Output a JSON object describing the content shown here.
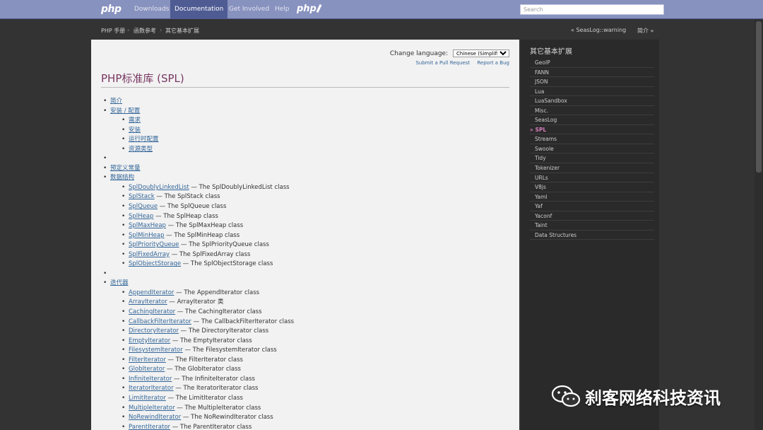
{
  "topnav": {
    "logo": "php",
    "links": [
      "Downloads",
      "Documentation",
      "Get Involved",
      "Help"
    ],
    "logo2": "php",
    "search_placeholder": "Search"
  },
  "breadcrumb": {
    "items": [
      "PHP 手册",
      "函数参考",
      "其它基本扩展"
    ],
    "prev": "« SeasLog::warning",
    "next": "简介 »"
  },
  "content": {
    "change_language_label": "Change language:",
    "language_selected": "Chinese (Simplified)",
    "submit_pull_request": "Submit a Pull Request",
    "report_bug": "Report a Bug",
    "title": "PHP标准库 (SPL)",
    "toc": {
      "intro": "简介",
      "setup": "安装 / 配置",
      "setup_items": [
        "需求",
        "安装",
        "运行时配置",
        "资源类型"
      ],
      "constants": "预定义常量",
      "datastructures": "数据结构",
      "ds_items": [
        {
          "link": "SplDoublyLinkedList",
          "desc": " — The SplDoublyLinkedList class"
        },
        {
          "link": "SplStack",
          "desc": " — The SplStack class"
        },
        {
          "link": "SplQueue",
          "desc": " — The SplQueue class"
        },
        {
          "link": "SplHeap",
          "desc": " — The SplHeap class"
        },
        {
          "link": "SplMaxHeap",
          "desc": " — The SplMaxHeap class"
        },
        {
          "link": "SplMinHeap",
          "desc": " — The SplMinHeap class"
        },
        {
          "link": "SplPriorityQueue",
          "desc": " — The SplPriorityQueue class"
        },
        {
          "link": "SplFixedArray",
          "desc": " — The SplFixedArray class"
        },
        {
          "link": "SplObjectStorage",
          "desc": " — The SplObjectStorage class"
        }
      ],
      "iterators": "迭代器",
      "it_items": [
        {
          "link": "AppendIterator",
          "desc": " — The AppendIterator class"
        },
        {
          "link": "ArrayIterator",
          "desc": " — ArrayIterator 类"
        },
        {
          "link": "CachingIterator",
          "desc": " — The CachingIterator class"
        },
        {
          "link": "CallbackFilterIterator",
          "desc": " — The CallbackFilterIterator class"
        },
        {
          "link": "DirectoryIterator",
          "desc": " — The DirectoryIterator class"
        },
        {
          "link": "EmptyIterator",
          "desc": " — The EmptyIterator class"
        },
        {
          "link": "FilesystemIterator",
          "desc": " — The FilesystemIterator class"
        },
        {
          "link": "FilterIterator",
          "desc": " — The FilterIterator class"
        },
        {
          "link": "GlobIterator",
          "desc": " — The GlobIterator class"
        },
        {
          "link": "InfiniteIterator",
          "desc": " — The InfiniteIterator class"
        },
        {
          "link": "IteratorIterator",
          "desc": " — The IteratorIterator class"
        },
        {
          "link": "LimitIterator",
          "desc": " — The LimitIterator class"
        },
        {
          "link": "MultipleIterator",
          "desc": " — The MultipleIterator class"
        },
        {
          "link": "NoRewindIterator",
          "desc": " — The NoRewindIterator class"
        },
        {
          "link": "ParentIterator",
          "desc": " — The ParentIterator class"
        }
      ]
    }
  },
  "sidebar": {
    "title": "其它基本扩展",
    "items": [
      "GeoIP",
      "FANN",
      "JSON",
      "Lua",
      "LuaSandbox",
      "Misc.",
      "SeasLog",
      "» SPL",
      "Streams",
      "Swoole",
      "Tidy",
      "Tokenizer",
      "URLs",
      "V8js",
      "Yaml",
      "Yaf",
      "Yaconf",
      "Taint",
      "Data Structures"
    ],
    "current_index": 7
  },
  "watermark": "刹客网络科技资讯",
  "colors": {
    "nav_bg": "#8892bf",
    "nav_active": "#4f5b93",
    "title": "#793862",
    "link": "#336699",
    "sidebar_current": "#d47cbb"
  }
}
